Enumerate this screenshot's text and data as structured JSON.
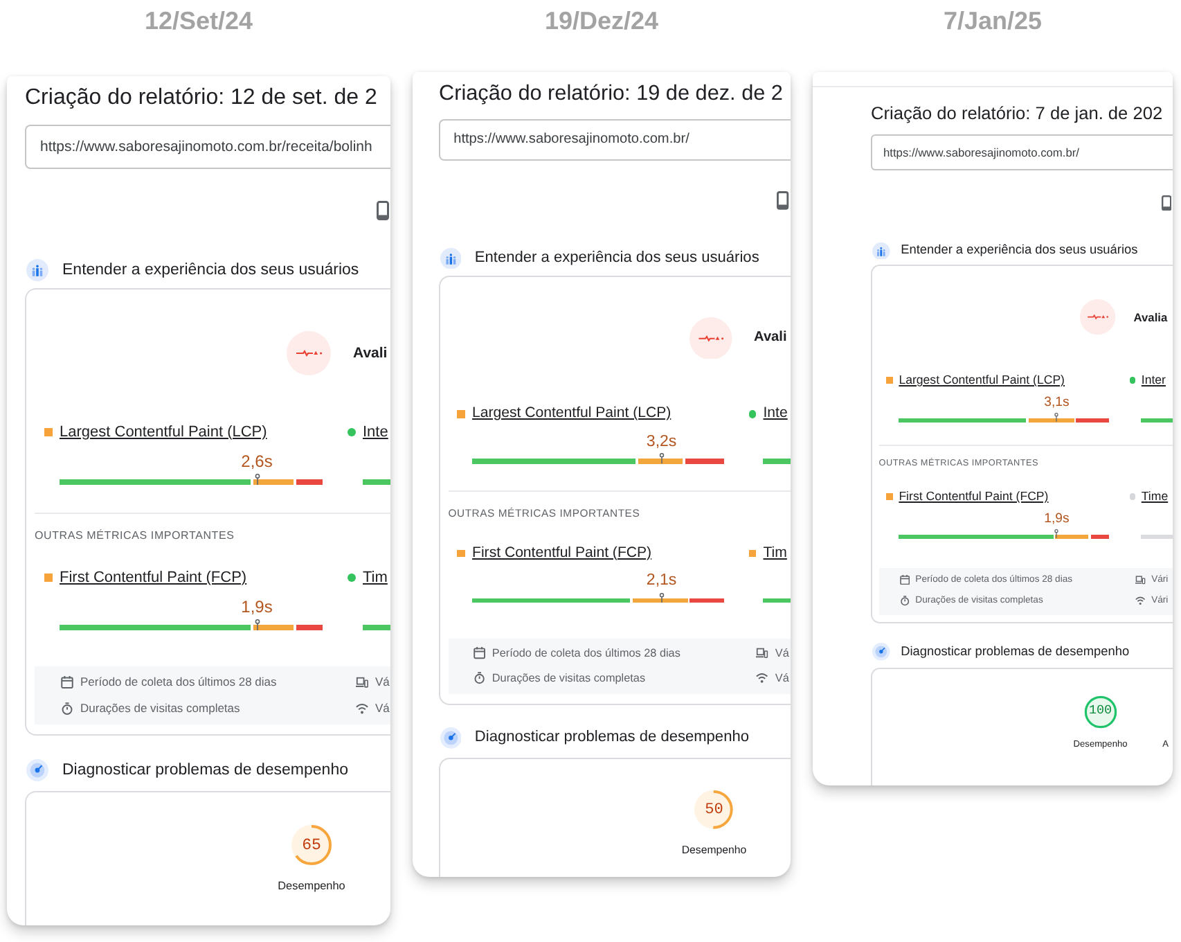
{
  "reports": [
    {
      "date_label": "12/Set/24",
      "title": "Criação do relatório: 12 de set. de 2",
      "url": "https://www.saboresajinomoto.com.br/receita/bolinh",
      "experience": {
        "heading": "Entender a experiência dos seus usuários",
        "assessment": "Avali",
        "core_metrics": [
          {
            "name": "Largest Contentful Paint (LCP)",
            "kind": "average",
            "value": "2,6s"
          },
          {
            "name": "Inte",
            "kind": "good"
          }
        ],
        "other_heading": "OUTRAS MÉTRICAS IMPORTANTES",
        "other_metrics": [
          {
            "name": "First Contentful Paint (FCP)",
            "kind": "average",
            "value": "1,9s"
          },
          {
            "name": "Tim",
            "kind": "good"
          }
        ],
        "info": [
          {
            "kind": "calendar",
            "text": "Período de coleta dos últimos 28 dias"
          },
          {
            "kind": "devices",
            "text": "Vá"
          },
          {
            "kind": "stopwatch",
            "text": "Durações de visitas completas"
          },
          {
            "kind": "wifi",
            "text": "Vá"
          }
        ]
      },
      "diagnosis": {
        "heading": "Diagnosticar problemas de desempenho",
        "scores": [
          {
            "label": "Desempenho",
            "value": "65",
            "kind": "average",
            "level": 0.65
          }
        ]
      }
    },
    {
      "date_label": "19/Dez/24",
      "title": "Criação do relatório: 19 de dez. de 2",
      "url": "https://www.saboresajinomoto.com.br/",
      "experience": {
        "heading": "Entender a experiência dos seus usuários",
        "assessment": "Avali",
        "core_metrics": [
          {
            "name": "Largest Contentful Paint (LCP)",
            "kind": "average",
            "value": "3,2s"
          },
          {
            "name": "Inte",
            "kind": "good"
          }
        ],
        "other_heading": "OUTRAS MÉTRICAS IMPORTANTES",
        "other_metrics": [
          {
            "name": "First Contentful Paint (FCP)",
            "kind": "average",
            "value": "2,1s"
          },
          {
            "name": "Tim",
            "kind": "average"
          }
        ],
        "info": [
          {
            "kind": "calendar",
            "text": "Período de coleta dos últimos 28 dias"
          },
          {
            "kind": "devices",
            "text": "Vá"
          },
          {
            "kind": "stopwatch",
            "text": "Durações de visitas completas"
          },
          {
            "kind": "wifi",
            "text": "Vá"
          }
        ]
      },
      "diagnosis": {
        "heading": "Diagnosticar problemas de desempenho",
        "scores": [
          {
            "label": "Desempenho",
            "value": "50",
            "kind": "average",
            "level": 0.5
          }
        ]
      }
    },
    {
      "date_label": "7/Jan/25",
      "title": "Criação do relatório: 7 de jan. de 202",
      "url": "https://www.saboresajinomoto.com.br/",
      "experience": {
        "heading": "Entender a experiência dos seus usuários",
        "assessment": "Avalia",
        "core_metrics": [
          {
            "name": "Largest Contentful Paint (LCP)",
            "kind": "average",
            "value": "3,1s"
          },
          {
            "name": "Inter",
            "kind": "good"
          }
        ],
        "other_heading": "OUTRAS MÉTRICAS IMPORTANTES",
        "other_metrics": [
          {
            "name": "First Contentful Paint (FCP)",
            "kind": "average",
            "value": "1,9s"
          },
          {
            "name": "Time",
            "kind": "empty"
          }
        ],
        "info": [
          {
            "kind": "calendar",
            "text": "Período de coleta dos últimos 28 dias"
          },
          {
            "kind": "devices",
            "text": "Vári"
          },
          {
            "kind": "stopwatch",
            "text": "Durações de visitas completas"
          },
          {
            "kind": "wifi",
            "text": "Vári"
          }
        ]
      },
      "diagnosis": {
        "heading": "Diagnosticar problemas de desempenho",
        "scores": [
          {
            "label": "Desempenho",
            "value": "100",
            "kind": "good",
            "level": 1
          },
          {
            "label": "A"
          }
        ]
      }
    }
  ]
}
